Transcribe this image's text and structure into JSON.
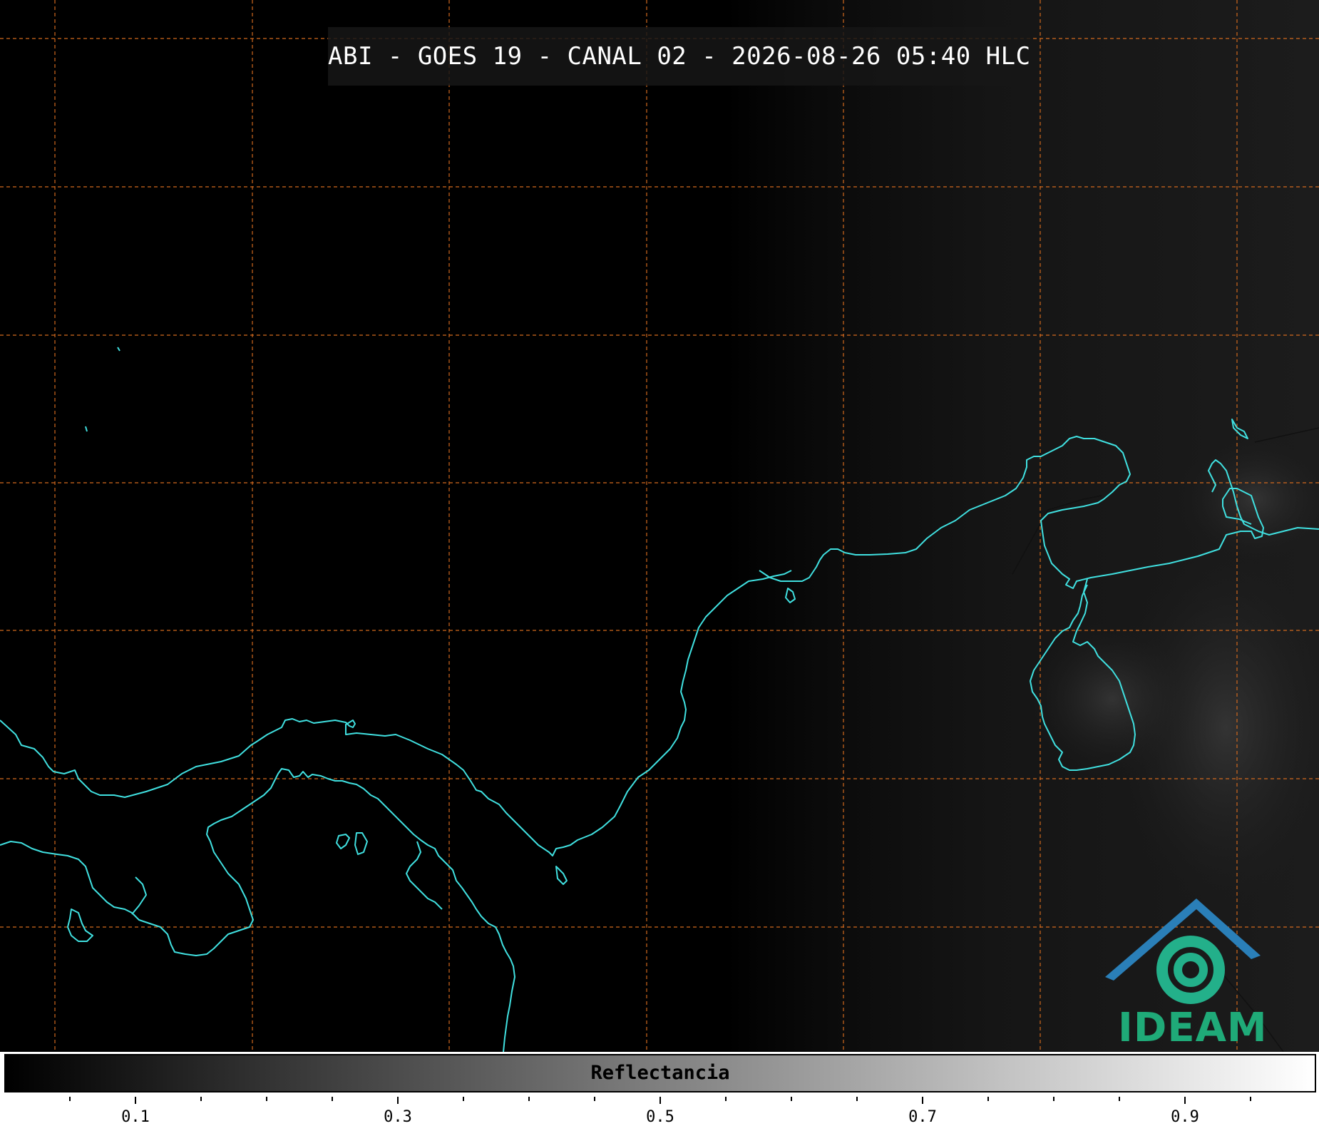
{
  "title": "ABI - GOES 19 - CANAL 02 - 2026-08-26 05:40 HLC",
  "logo": {
    "text": "IDEAM",
    "colors": {
      "roof": "#2a7fb8",
      "swirl": "#23b08a",
      "text": "#1faa78"
    }
  },
  "colorbar": {
    "label": "Reflectancia",
    "min": 0.0,
    "max": 1.0,
    "colormap": "greys",
    "major_ticks": [
      "0.1",
      "0.3",
      "0.5",
      "0.7",
      "0.9"
    ],
    "major_values": [
      0.1,
      0.3,
      0.5,
      0.7,
      0.9
    ],
    "minor_values": [
      0.05,
      0.15,
      0.2,
      0.25,
      0.35,
      0.4,
      0.45,
      0.55,
      0.6,
      0.65,
      0.75,
      0.8,
      0.85,
      0.95
    ]
  },
  "map": {
    "background": "#000000",
    "coastline_color": "#40e0e0",
    "graticule_color": "#d2691e",
    "graticule_style": "dashed"
  }
}
